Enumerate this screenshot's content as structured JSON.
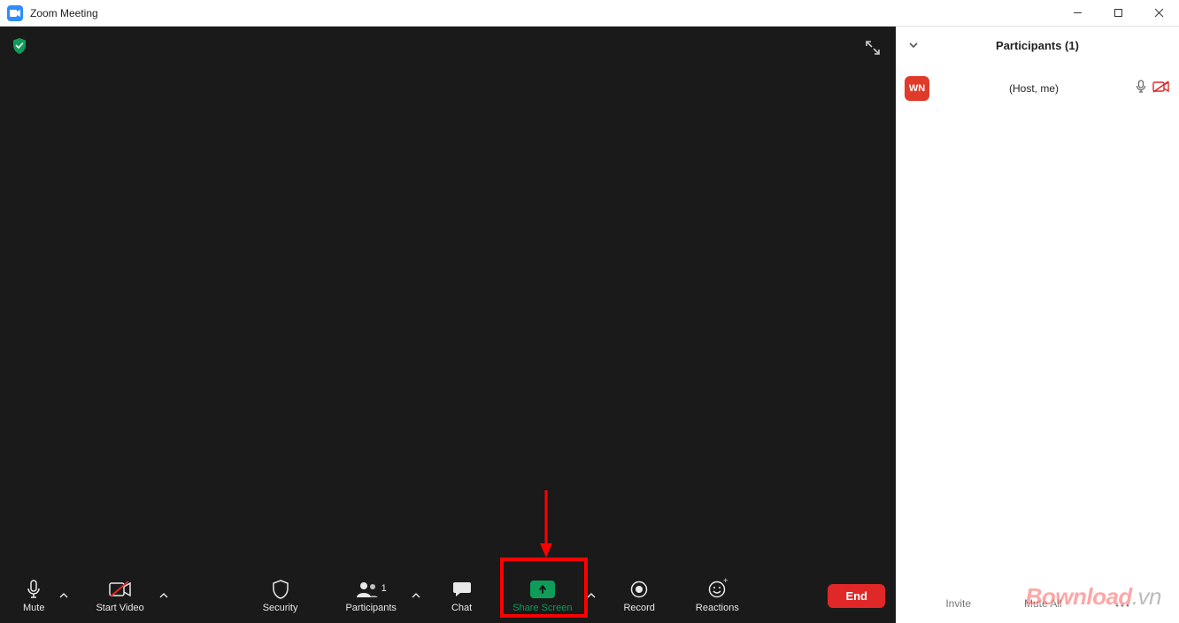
{
  "titlebar": {
    "title": "Zoom Meeting"
  },
  "toolbar": {
    "mute": "Mute",
    "start_video": "Start Video",
    "security": "Security",
    "participants": "Participants",
    "participants_count": "1",
    "chat": "Chat",
    "share_screen": "Share Screen",
    "record": "Record",
    "reactions": "Reactions",
    "end": "End"
  },
  "participants_panel": {
    "title": "Participants (1)",
    "rows": [
      {
        "initials": "WN",
        "label": "(Host, me)"
      }
    ],
    "footer": {
      "invite": "Invite",
      "mute_all": "Mute All"
    }
  },
  "watermark": {
    "brand": "Bownload",
    "tld": ".vn"
  },
  "colors": {
    "accent_green": "#0e9d58",
    "end_red": "#e02828",
    "avatar_red": "#e03a2a",
    "zoom_blue": "#2d8cff",
    "annotation_red": "#ff0000"
  }
}
